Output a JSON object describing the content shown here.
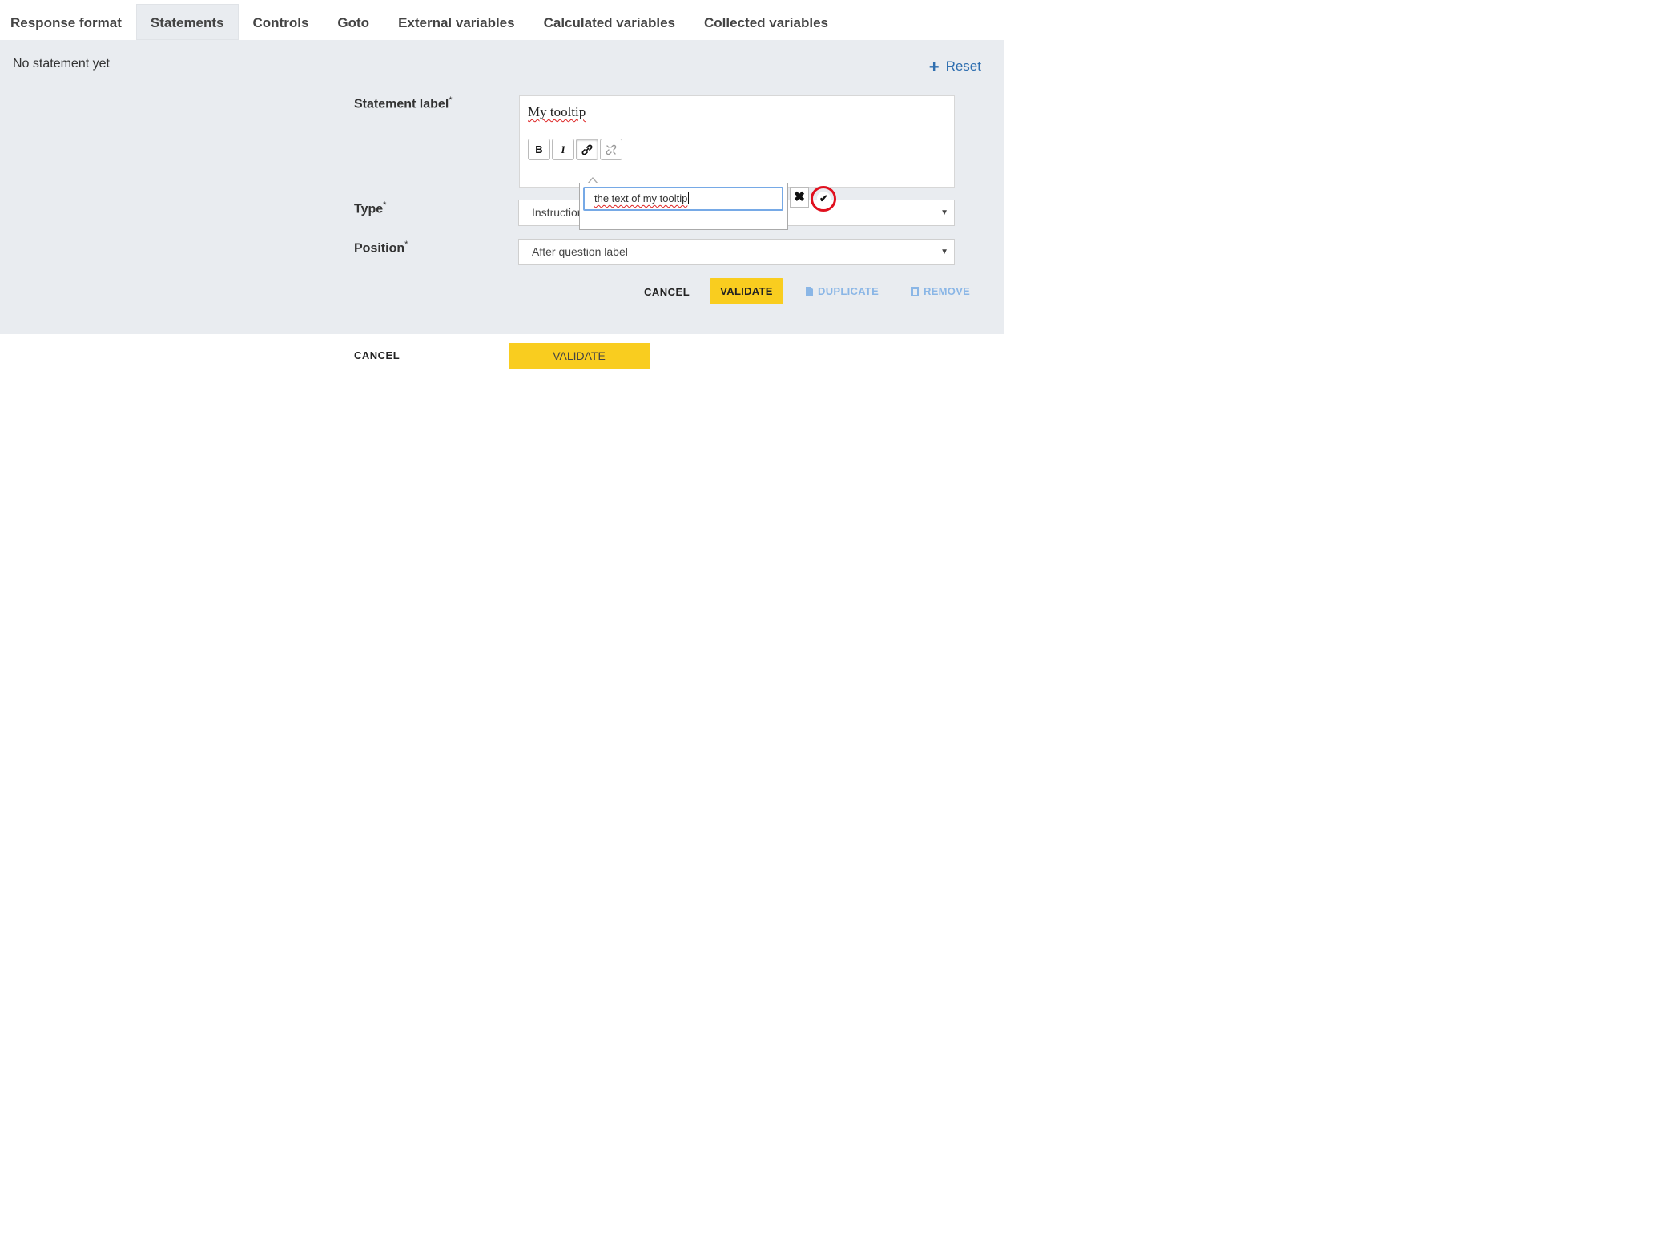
{
  "tabs": [
    {
      "label": "Response format",
      "active": false
    },
    {
      "label": "Statements",
      "active": true
    },
    {
      "label": "Controls",
      "active": false
    },
    {
      "label": "Goto",
      "active": false
    },
    {
      "label": "External variables",
      "active": false
    },
    {
      "label": "Calculated variables",
      "active": false
    },
    {
      "label": "Collected variables",
      "active": false
    }
  ],
  "panel": {
    "empty_message": "No statement yet",
    "reset_label": "Reset"
  },
  "form": {
    "statement_label": {
      "label": "Statement label",
      "required_mark": "*",
      "value": "My tooltip"
    },
    "type": {
      "label": "Type",
      "required_mark": "*",
      "value": "Instruction"
    },
    "position": {
      "label": "Position",
      "required_mark": "*",
      "value": "After question label"
    }
  },
  "toolbar": {
    "bold": "B",
    "italic": "I"
  },
  "link_popup": {
    "input_value": "the text of my tooltip",
    "cancel_symbol": "✖",
    "confirm_symbol": "✔"
  },
  "actions": {
    "cancel": "CANCEL",
    "validate": "VALIDATE",
    "duplicate": "DUPLICATE",
    "remove": "REMOVE"
  },
  "footer": {
    "cancel": "CANCEL",
    "validate": "VALIDATE"
  },
  "colors": {
    "accent_yellow": "#f9cd1f",
    "link_blue": "#2f6fb0",
    "highlight_red": "#e0101e",
    "panel_bg": "#e9ecf0"
  }
}
